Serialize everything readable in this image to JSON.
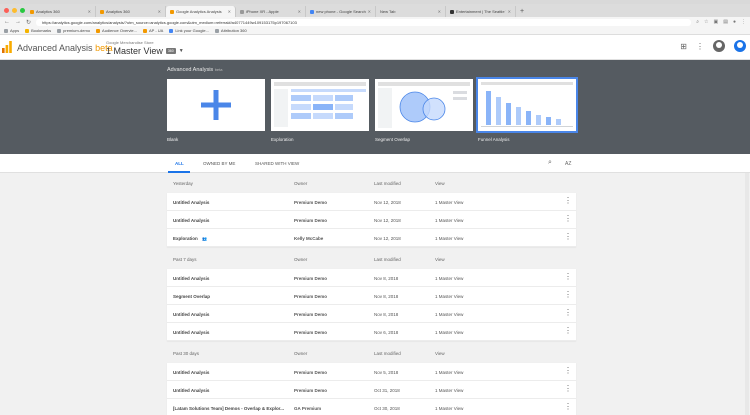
{
  "browser": {
    "tabs": [
      {
        "label": "Analytics 360"
      },
      {
        "label": "Analytics 360"
      },
      {
        "label": "Google Analytics Analysis"
      },
      {
        "label": "iPhone XR - Apple"
      },
      {
        "label": "new phone - Google Search"
      },
      {
        "label": "New Tab"
      },
      {
        "label": "Entertainment | The Seattle T"
      }
    ],
    "url": "https://analytics.google.com/analytics/analysis/?utm_source=analytics.google.com&utm_medium=referral#/a40771449w109153175p197067103",
    "bookmarks": [
      "Apps",
      "Bookmarks",
      "premium-demo",
      "Audience Overvie...",
      "AP - UA",
      "Link your Google...",
      "Attribution 360"
    ]
  },
  "header": {
    "product": "Advanced Analysis",
    "beta": "beta",
    "account": "Google Merchandise Store",
    "view": "1 Master View",
    "view_badge": "360"
  },
  "gallery": {
    "title": "Advanced Analysis",
    "title_suffix": "beta",
    "templates": [
      {
        "label": "Blank"
      },
      {
        "label": "Exploration"
      },
      {
        "label": "Segment Overlap"
      },
      {
        "label": "Funnel Analysis"
      }
    ]
  },
  "filters": {
    "tabs": [
      "ALL",
      "OWNED BY ME",
      "SHARED WITH VIEW"
    ],
    "sort_label": "AZ"
  },
  "sections": [
    {
      "period": "Yesterday",
      "owner_h": "Owner",
      "modified_h": "Last modified",
      "view_h": "View",
      "rows": [
        {
          "name": "Untitled Analysis",
          "owner": "Premium Demo",
          "modified": "Nov 12, 2018",
          "view": "1 Master View"
        },
        {
          "name": "Untitled Analysis",
          "owner": "Premium Demo",
          "modified": "Nov 12, 2018",
          "view": "1 Master View"
        },
        {
          "name": "Exploration",
          "owner": "Kelly McCabe",
          "modified": "Nov 12, 2018",
          "view": "1 Master View",
          "shared": true
        }
      ]
    },
    {
      "period": "Past 7 days",
      "owner_h": "Owner",
      "modified_h": "Last modified",
      "view_h": "View",
      "rows": [
        {
          "name": "Untitled Analysis",
          "owner": "Premium Demo",
          "modified": "Nov 8, 2018",
          "view": "1 Master View"
        },
        {
          "name": "Segment Overlap",
          "owner": "Premium Demo",
          "modified": "Nov 8, 2018",
          "view": "1 Master View"
        },
        {
          "name": "Untitled Analysis",
          "owner": "Premium Demo",
          "modified": "Nov 8, 2018",
          "view": "1 Master View"
        },
        {
          "name": "Untitled Analysis",
          "owner": "Premium Demo",
          "modified": "Nov 6, 2018",
          "view": "1 Master View"
        }
      ]
    },
    {
      "period": "Past 30 days",
      "owner_h": "Owner",
      "modified_h": "Last modified",
      "view_h": "View",
      "rows": [
        {
          "name": "Untitled Analysis",
          "owner": "Premium Demo",
          "modified": "Nov 5, 2018",
          "view": "1 Master View"
        },
        {
          "name": "Untitled Analysis",
          "owner": "Premium Demo",
          "modified": "Oct 31, 2018",
          "view": "1 Master View"
        },
        {
          "name": "[Latam Solutions Team] Demos - Overlap & Explor...",
          "owner": "GA Premium",
          "modified": "Oct 30, 2018",
          "view": "1 Master View"
        }
      ]
    }
  ],
  "colors": {
    "accent": "#1a73e8",
    "beta": "#f29900",
    "gallery_bg": "#555b61"
  }
}
